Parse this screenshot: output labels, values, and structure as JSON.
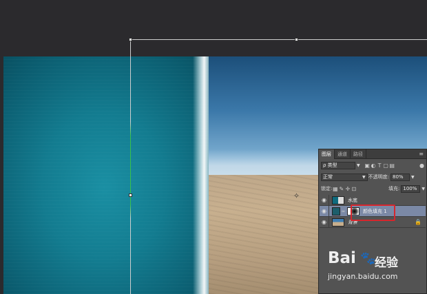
{
  "panel": {
    "tabs": [
      "图层",
      "通道",
      "路径"
    ],
    "menu_icon": "panel-menu-icon",
    "filter": {
      "kind_label": "ρ 类型"
    },
    "blend_mode": "正常",
    "opacity_label": "不透明度:",
    "opacity_value": "80%",
    "lock_label": "锁定:",
    "fill_label": "填充:",
    "fill_value": "100%",
    "layers": [
      {
        "name": "水底",
        "visible": true,
        "selected": false,
        "italic": false,
        "locked": false
      },
      {
        "name": "颜色填充 1",
        "visible": true,
        "selected": true,
        "italic": false,
        "locked": false
      },
      {
        "name": "背景",
        "visible": true,
        "selected": false,
        "italic": true,
        "locked": true
      }
    ]
  },
  "watermark": {
    "logo": "Bai",
    "service": "经验",
    "url": "jingyan.baidu.com"
  },
  "colors": {
    "workspace": "#2b2a2d",
    "panel": "#535353",
    "selected_layer": "#7b89a6",
    "highlight": "#d7262d"
  }
}
